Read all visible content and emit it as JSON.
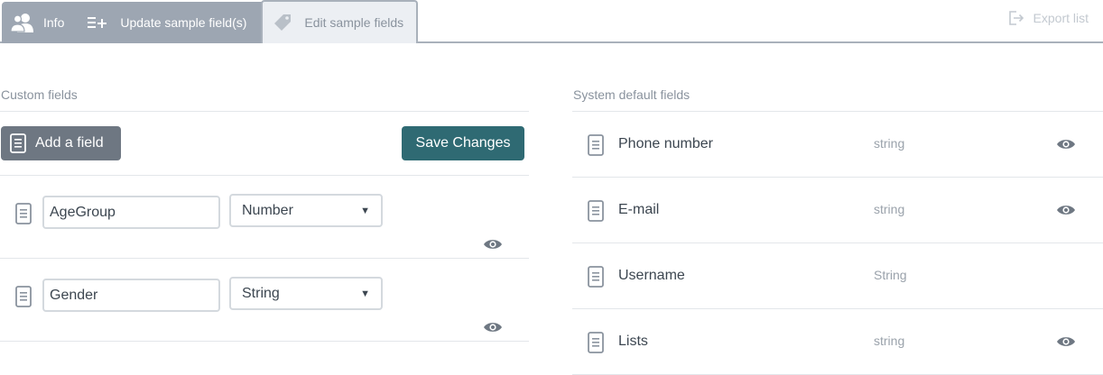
{
  "tabs": [
    {
      "label": "Info",
      "icon": "users-icon",
      "active": false
    },
    {
      "label": "Update sample field(s)",
      "icon": "list-add-icon",
      "active": false
    },
    {
      "label": "Edit sample fields",
      "icon": "tag-icon",
      "active": true
    }
  ],
  "export": {
    "label": "Export list",
    "icon": "export-icon"
  },
  "custom": {
    "title": "Custom fields",
    "add_label": "Add a field",
    "save_label": "Save Changes",
    "fields": [
      {
        "name": "AgeGroup",
        "type": "Number"
      },
      {
        "name": "Gender",
        "type": "String"
      }
    ]
  },
  "system": {
    "title": "System default fields",
    "fields": [
      {
        "name": "Phone number",
        "type": "string",
        "visible_toggle": true
      },
      {
        "name": "E-mail",
        "type": "string",
        "visible_toggle": true
      },
      {
        "name": "Username",
        "type": "String",
        "visible_toggle": false
      },
      {
        "name": "Lists",
        "type": "string",
        "visible_toggle": true
      }
    ]
  },
  "colors": {
    "tab_bg": "#9da6b2",
    "add_button": "#6e7782",
    "save_button": "#2f6a73",
    "icon_gray": "#8a939e"
  }
}
